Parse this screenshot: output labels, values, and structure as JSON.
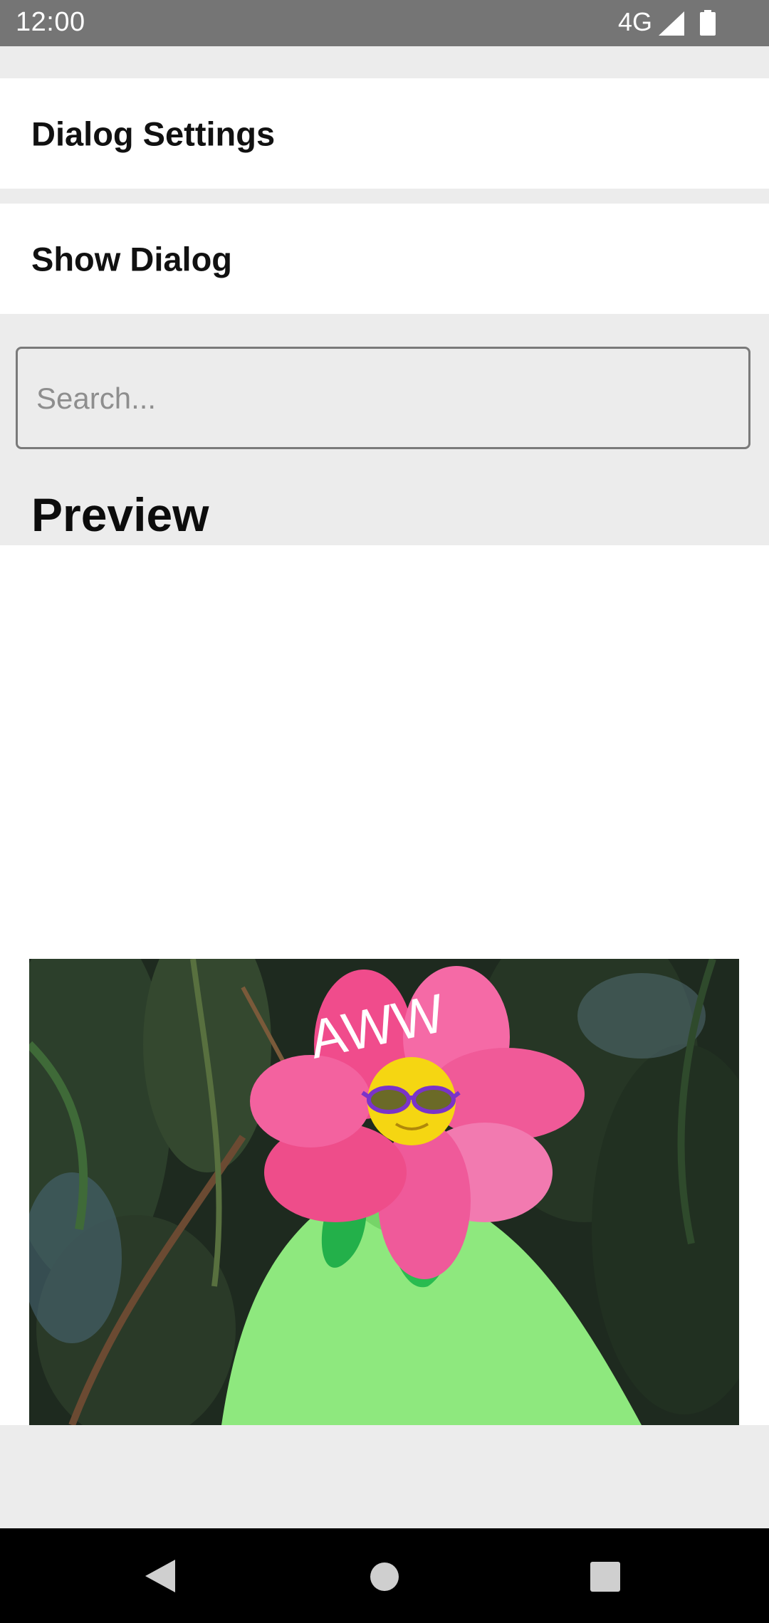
{
  "status_bar": {
    "time": "12:00",
    "network": "4G",
    "icons": [
      "signal-icon",
      "battery-icon"
    ]
  },
  "menu": {
    "items": [
      {
        "label": "Dialog Settings"
      },
      {
        "label": "Show Dialog"
      }
    ]
  },
  "search": {
    "value": "",
    "placeholder": "Search..."
  },
  "preview": {
    "title": "Preview",
    "image_caption": "AWW"
  },
  "nav_bar": {
    "icons": [
      "back-icon",
      "home-icon",
      "recents-icon"
    ]
  },
  "colors": {
    "status_bar": "#757575",
    "background": "#ececec",
    "surface": "#ffffff",
    "nav_bar": "#000000"
  }
}
